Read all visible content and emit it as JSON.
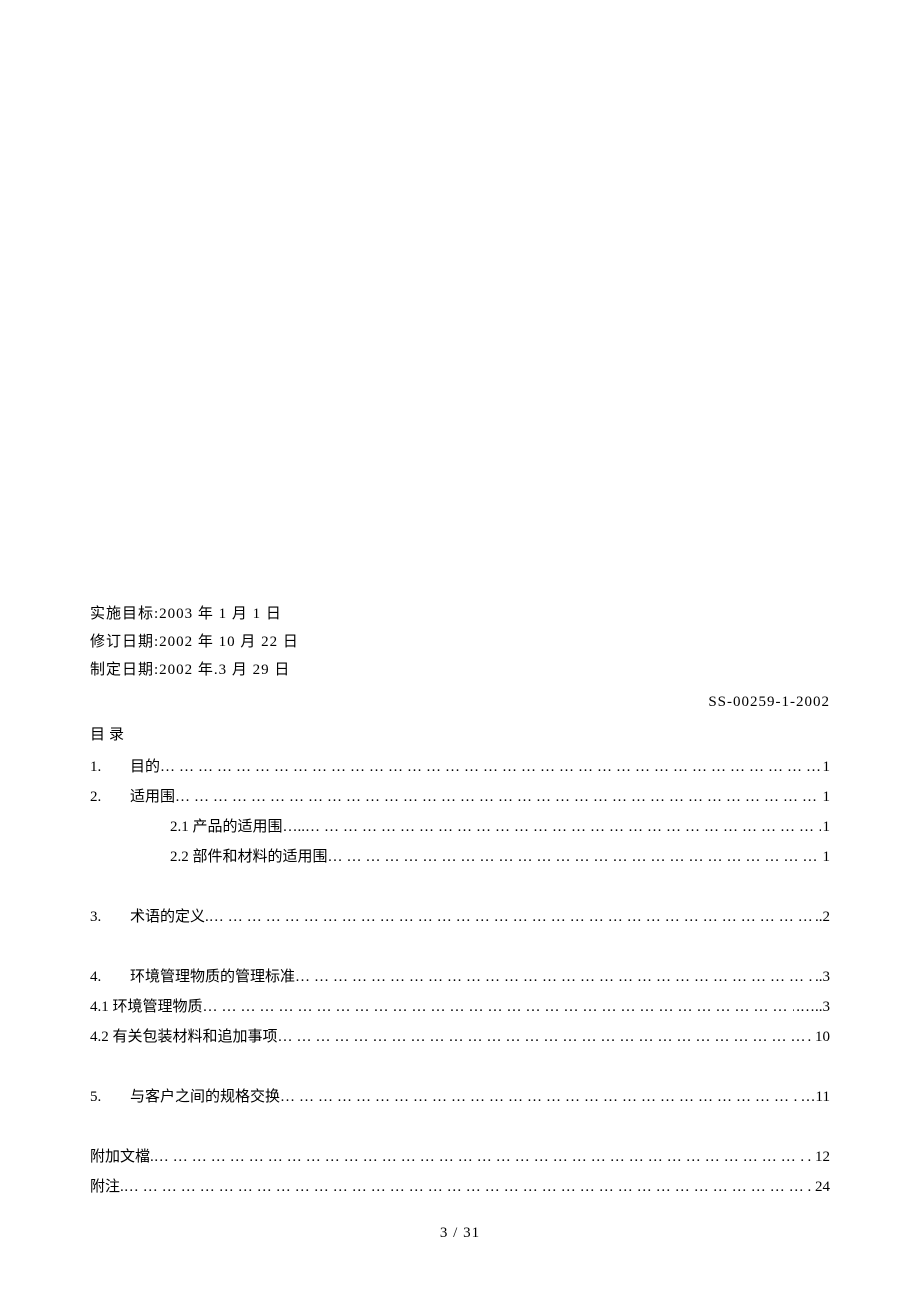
{
  "dates": {
    "line1": "实施目标:2003 年 1 月 1 日",
    "line2": "修订日期:2002 年 10 月 22 日",
    "line3": "制定日期:2002 年.3 月 29 日"
  },
  "document_id": "SS-00259-1-2002",
  "toc_heading": "目录",
  "toc": [
    {
      "num": "1.",
      "label": "目的",
      "page": "1",
      "indent": false,
      "noNumCol": false
    },
    {
      "num": "2.",
      "label": "适用围",
      "page": "1",
      "indent": false,
      "noNumCol": false
    },
    {
      "num": "",
      "label": "2.1 产品的适用围…..",
      "page": "1",
      "indent": true,
      "noNumCol": false
    },
    {
      "num": "",
      "label": "2.2 部件和材料的适用围",
      "page": "1",
      "indent": true,
      "noNumCol": false
    },
    {
      "gap": true
    },
    {
      "num": "3.",
      "label": "术语的定义.",
      "page": "..2",
      "indent": false,
      "noNumCol": false
    },
    {
      "gap": true
    },
    {
      "num": "4.",
      "label": "环境管理物质的管理标准",
      "page": "..3",
      "indent": false,
      "noNumCol": false
    },
    {
      "num": "",
      "label": "4.1 环境管理物质",
      "page": ".…..3",
      "indent": false,
      "noNumCol": true
    },
    {
      "num": "",
      "label": "4.2 有关包装材料和追加事项",
      "page": ". 10",
      "indent": false,
      "noNumCol": true
    },
    {
      "gap": true
    },
    {
      "num": "5.",
      "label": "与客户之间的规格交换",
      "page": "…11",
      "indent": false,
      "noNumCol": false
    },
    {
      "gap": true
    },
    {
      "num": "",
      "label": "附加文檔.",
      "page": ". 12",
      "indent": false,
      "noNumCol": true
    },
    {
      "num": "",
      "label": "附注.",
      "page": ". 24",
      "indent": false,
      "noNumCol": true
    }
  ],
  "footer": "3 / 31"
}
